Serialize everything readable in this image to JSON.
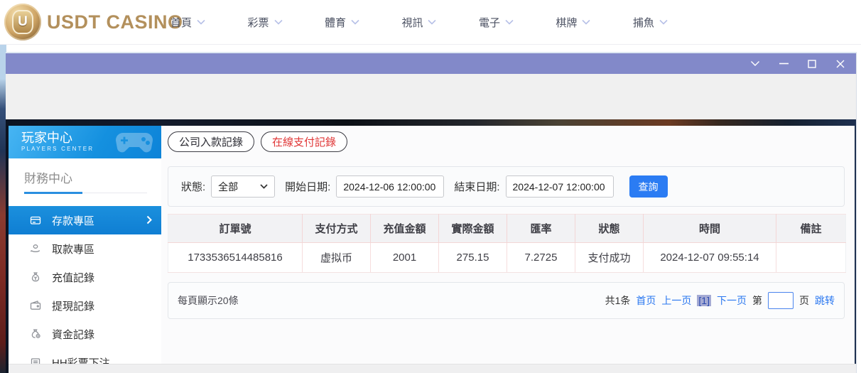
{
  "header": {
    "logo_symbol": "U",
    "logo_text": "USDT CASINO",
    "nav": [
      "首頁",
      "彩票",
      "體育",
      "視訊",
      "電子",
      "棋牌",
      "捕魚"
    ]
  },
  "sidebar": {
    "title": "玩家中心",
    "subtitle": "PLAYERS CENTER",
    "section": "財務中心",
    "items": [
      {
        "label": "存款專區",
        "active": true
      },
      {
        "label": "取款專區",
        "active": false
      },
      {
        "label": "充值記錄",
        "active": false
      },
      {
        "label": "提現記錄",
        "active": false
      },
      {
        "label": "資金記錄",
        "active": false
      },
      {
        "label": "HH彩票下注",
        "active": false
      }
    ]
  },
  "tabs": [
    {
      "label": "公司入款記錄"
    },
    {
      "label": "在線支付記錄"
    }
  ],
  "filters": {
    "status_label": "狀態:",
    "status_value": "全部",
    "start_label": "開始日期:",
    "start_value": "2024-12-06 12:00:00",
    "end_label": "結束日期:",
    "end_value": "2024-12-07 12:00:00",
    "search_label": "查詢"
  },
  "table": {
    "columns": [
      "訂單號",
      "支付方式",
      "充值金額",
      "實際金額",
      "匯率",
      "狀態",
      "時間",
      "備註"
    ],
    "rows": [
      [
        "1733536514485816",
        "虚拟币",
        "2001",
        "275.15",
        "7.2725",
        "支付成功",
        "2024-12-07 09:55:14",
        ""
      ]
    ]
  },
  "pagination": {
    "page_size_text": "每頁顯示20條",
    "total_text": "共1条",
    "first_label": "首页",
    "prev_label": "上一页",
    "current_label": "[1]",
    "next_label": "下一页",
    "jump_prefix": "第",
    "jump_suffix": "页",
    "jump_label": "跳转",
    "jump_value": ""
  },
  "colors": {
    "titlebar": "#8289c9",
    "sidebar_blue": "#1490df",
    "active_item": "#147fd6",
    "search_button": "#2b7cf3",
    "tab_red": "#e03636",
    "link_blue": "#2a77f0",
    "logo_gold": "#b3905c",
    "table_divider_pink": "#f3d6d6"
  }
}
